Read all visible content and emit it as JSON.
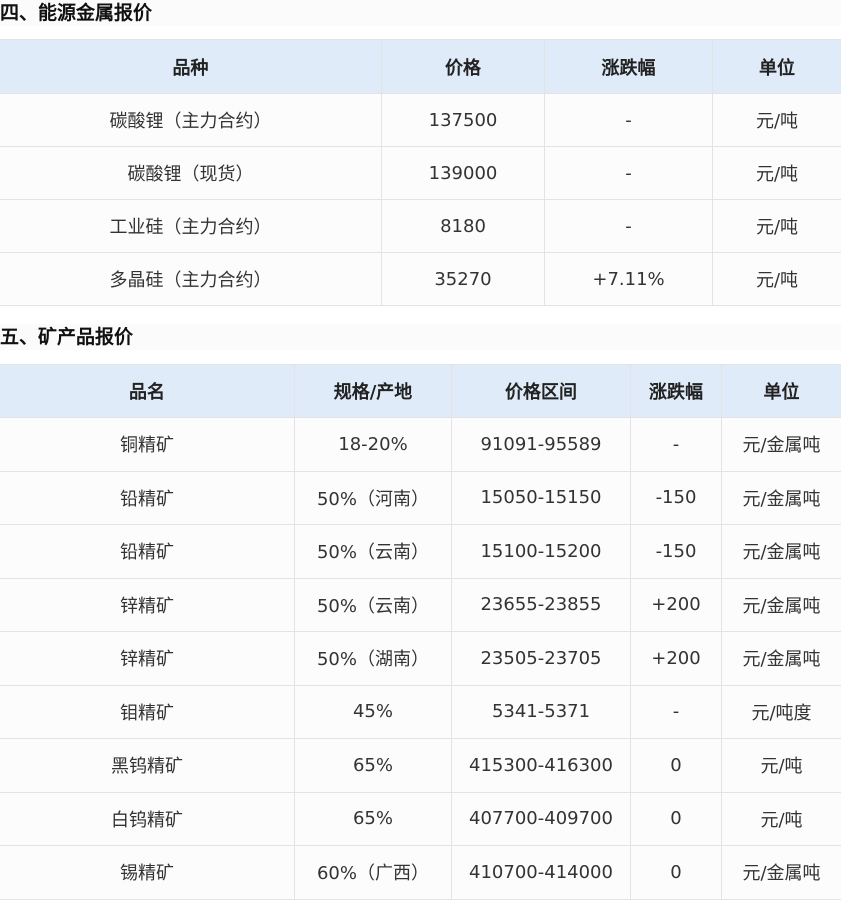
{
  "section4": {
    "title": "四、能源金属报价",
    "headers": [
      "品种",
      "价格",
      "涨跌幅",
      "单位"
    ],
    "rows": [
      [
        "碳酸锂（主力合约）",
        "137500",
        "-",
        "元/吨"
      ],
      [
        "碳酸锂（现货）",
        "139000",
        "-",
        "元/吨"
      ],
      [
        "工业硅（主力合约）",
        "8180",
        "-",
        "元/吨"
      ],
      [
        "多晶硅（主力合约）",
        "35270",
        "+7.11%",
        "元/吨"
      ]
    ]
  },
  "section5": {
    "title": "五、矿产品报价",
    "headers": [
      "品名",
      "规格/产地",
      "价格区间",
      "涨跌幅",
      "单位"
    ],
    "rows": [
      [
        "铜精矿",
        "18-20%",
        "91091-95589",
        "-",
        "元/金属吨"
      ],
      [
        "铅精矿",
        "50%（河南）",
        "15050-15150",
        "-150",
        "元/金属吨"
      ],
      [
        "铅精矿",
        "50%（云南）",
        "15100-15200",
        "-150",
        "元/金属吨"
      ],
      [
        "锌精矿",
        "50%（云南）",
        "23655-23855",
        "+200",
        "元/金属吨"
      ],
      [
        "锌精矿",
        "50%（湖南）",
        "23505-23705",
        "+200",
        "元/金属吨"
      ],
      [
        "钼精矿",
        "45%",
        "5341-5371",
        "-",
        "元/吨度"
      ],
      [
        "黑钨精矿",
        "65%",
        "415300-416300",
        "0",
        "元/吨"
      ],
      [
        "白钨精矿",
        "65%",
        "407700-409700",
        "0",
        "元/吨"
      ],
      [
        "锡精矿",
        "60%（广西）",
        "410700-414000",
        "0",
        "元/金属吨"
      ]
    ]
  }
}
